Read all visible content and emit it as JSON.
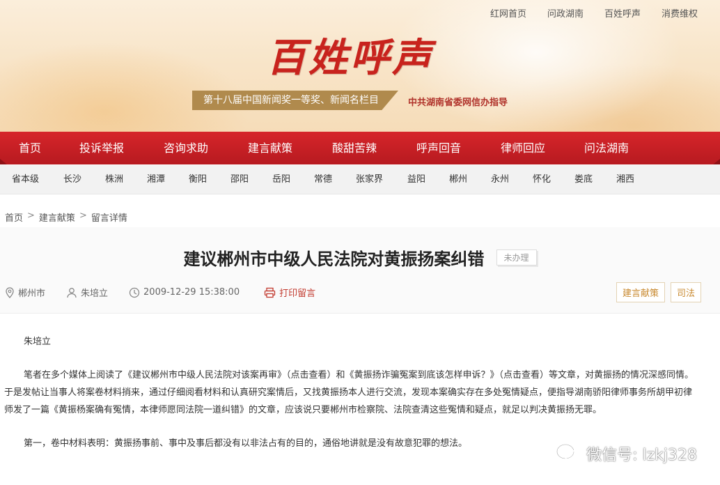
{
  "top_links": [
    "红网首页",
    "问政湖南",
    "百姓呼声",
    "消费维权"
  ],
  "logo": "百姓呼声",
  "award": "第十八届中国新闻奖一等奖、新闻名栏目",
  "guide": "中共湖南省委网信办指导",
  "nav": [
    "首页",
    "投诉举报",
    "咨询求助",
    "建言献策",
    "酸甜苦辣",
    "呼声回音",
    "律师回应",
    "问法湖南"
  ],
  "regions": [
    "省本级",
    "长沙",
    "株洲",
    "湘潭",
    "衡阳",
    "邵阳",
    "岳阳",
    "常德",
    "张家界",
    "益阳",
    "郴州",
    "永州",
    "怀化",
    "娄底",
    "湘西"
  ],
  "breadcrumb": {
    "home": "首页",
    "section": "建言献策",
    "page": "留言详情",
    "sep": ">"
  },
  "article": {
    "title": "建议郴州市中级人民法院对黄振扬案纠错",
    "status": "未办理",
    "location": "郴州市",
    "author": "朱培立",
    "datetime": "2009-12-29 15:38:00",
    "print_label": "打印留言",
    "tags": [
      "建言献策",
      "司法"
    ],
    "paragraphs": [
      "朱培立",
      "笔者在多个媒体上阅读了《建议郴州市中级人民法院对该案再审》（点击查看）和《黄振扬诈骗冤案到底该怎样申诉？》（点击查看）等文章，对黄振扬的情况深感同情。于是发帖让当事人将案卷材料捎来，通过仔细阅看材料和认真研究案情后，又找黄振扬本人进行交流，发现本案确实存在多处冤情疑点，便指导湖南骄阳律师事务所胡甲初律师发了一篇《黄振杨案确有冤情，本律师愿同法院一道纠错》的文章，应该说只要郴州市检察院、法院查清这些冤情和疑点，就足以判决黄振扬无罪。",
      "第一，卷中材料表明：黄振扬事前、事中及事后都没有以非法占有的目的，通俗地讲就是没有故意犯罪的想法。"
    ]
  },
  "watermark": "微信号: lzkj328",
  "colors": {
    "nav_red": "#c8202a",
    "accent_red": "#c8231d",
    "gold": "#b08a4d",
    "tag_gold": "#c8892f"
  }
}
